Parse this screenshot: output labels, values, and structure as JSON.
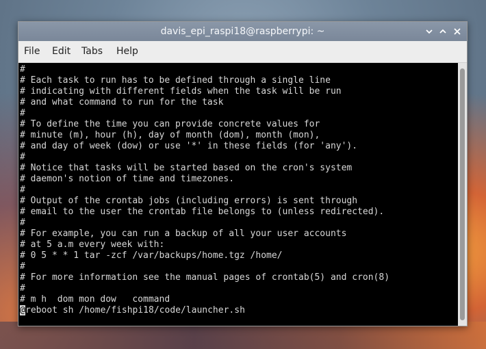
{
  "window": {
    "title": "davis_epi_raspi18@raspberrypi: ~",
    "controls": [
      "chevron-down-icon",
      "maximize-icon",
      "close-icon"
    ]
  },
  "menu": {
    "items": [
      "File",
      "Edit",
      "Tabs",
      "Help"
    ]
  },
  "terminal": {
    "lines": [
      "#",
      "# Each task to run has to be defined through a single line",
      "# indicating with different fields when the task will be run",
      "# and what command to run for the task",
      "#",
      "# To define the time you can provide concrete values for",
      "# minute (m), hour (h), day of month (dom), month (mon),",
      "# and day of week (dow) or use '*' in these fields (for 'any').",
      "#",
      "# Notice that tasks will be started based on the cron's system",
      "# daemon's notion of time and timezones.",
      "#",
      "# Output of the crontab jobs (including errors) is sent through",
      "# email to the user the crontab file belongs to (unless redirected).",
      "#",
      "# For example, you can run a backup of all your user accounts",
      "# at 5 a.m every week with:",
      "# 0 5 * * 1 tar -zcf /var/backups/home.tgz /home/",
      "#",
      "# For more information see the manual pages of crontab(5) and cron(8)",
      "#",
      "# m h  dom mon dow   command"
    ],
    "cursor_char": "@",
    "last_line_rest": "reboot sh /home/fishpi18/code/launcher.sh",
    "background": "#000000",
    "foreground": "#d8d8d8"
  },
  "scrollbar": {
    "thumb_start_fraction": 0.02,
    "thumb_size_fraction": 0.97
  },
  "colors": {
    "titlebar": "#7f8c9e",
    "menubar": "#ededed"
  }
}
